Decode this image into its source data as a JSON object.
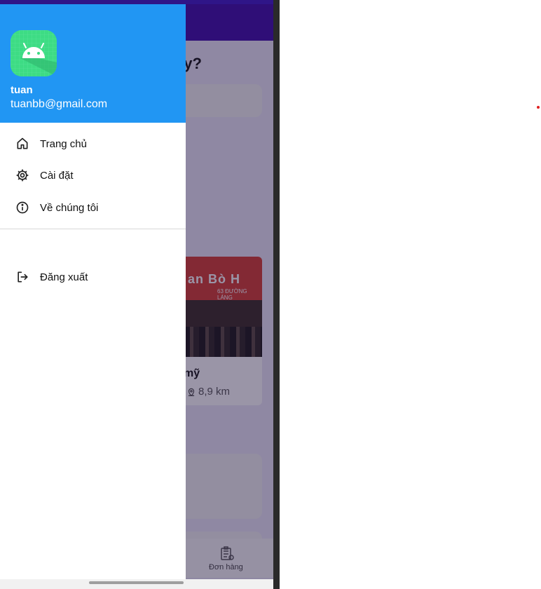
{
  "drawer": {
    "header": {
      "user_name": "tuan",
      "user_email": "tuanbb@gmail.com",
      "avatar_icon": "android-icon",
      "color": "#2196f3"
    },
    "menu": [
      {
        "label": "Trang chủ",
        "icon": "home-icon"
      },
      {
        "label": "Cài đặt",
        "icon": "gear-icon"
      },
      {
        "label": "Về chúng tôi",
        "icon": "info-icon"
      }
    ],
    "logout": {
      "label": "Đăng xuất",
      "icon": "logout-icon"
    }
  },
  "background_app": {
    "question_fragment": "ay?",
    "card": {
      "sign_text": "an Bò H",
      "sign_sub": "63 ĐƯỜNG LÁNG",
      "title_fragment": "mỹ",
      "distance": "8,9 km"
    },
    "bottom_nav": {
      "orders_label": "Đơn hàng"
    }
  }
}
